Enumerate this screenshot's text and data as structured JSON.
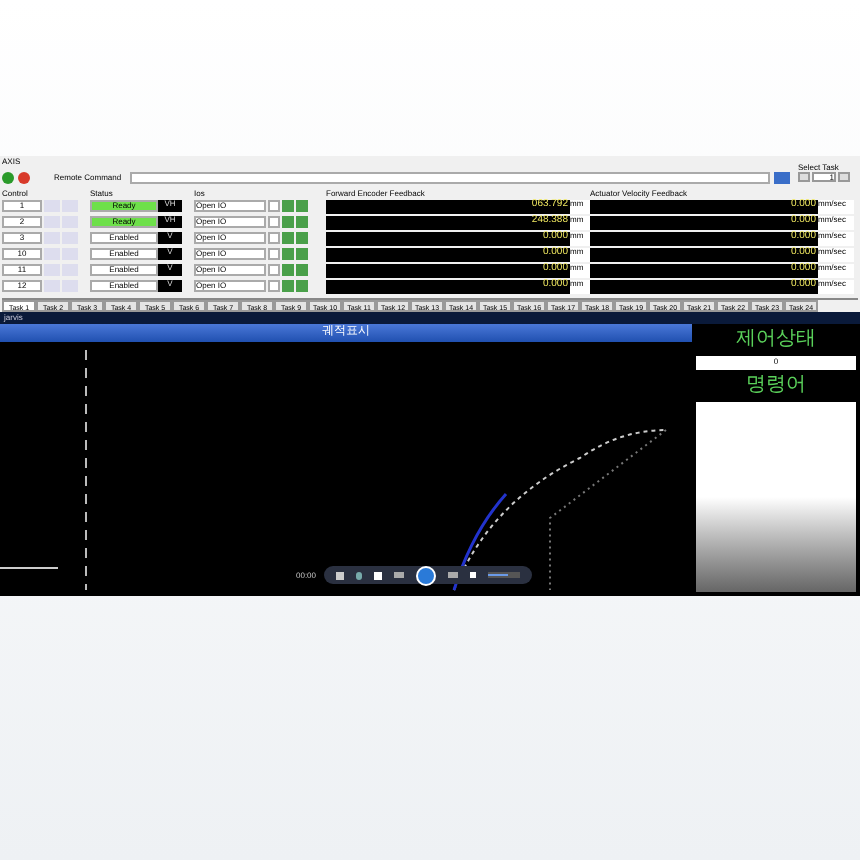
{
  "axis_panel": {
    "title": "AXIS",
    "remote_label": "Remote Command",
    "select_task": {
      "label": "Select Task",
      "value": "1"
    },
    "columns": [
      "Control",
      "Status",
      "Ios",
      "Forward Encoder Feedback",
      "Actuator Velocity Feedback"
    ],
    "rows": [
      {
        "control": "1",
        "checked": false,
        "status": "Ready",
        "ready": true,
        "mode": "VH",
        "io": "Open IO",
        "encoder": "063.792",
        "encoder_unit": "mm",
        "velocity": "0.000",
        "velocity_unit": "mm/sec"
      },
      {
        "control": "2",
        "checked": false,
        "status": "Ready",
        "ready": true,
        "mode": "VH",
        "io": "Open IO",
        "encoder": "248.388",
        "encoder_unit": "mm",
        "velocity": "0.000",
        "velocity_unit": "mm/sec"
      },
      {
        "control": "3",
        "checked": false,
        "status": "Enabled",
        "ready": false,
        "mode": "V",
        "io": "Open IO",
        "encoder": "0.000",
        "encoder_unit": "mm",
        "velocity": "0.000",
        "velocity_unit": "mm/sec"
      },
      {
        "control": "10",
        "checked": false,
        "status": "Enabled",
        "ready": false,
        "mode": "V",
        "io": "Open IO",
        "encoder": "0.000",
        "encoder_unit": "mm",
        "velocity": "0.000",
        "velocity_unit": "mm/sec"
      },
      {
        "control": "11",
        "checked": false,
        "status": "Enabled",
        "ready": false,
        "mode": "V",
        "io": "Open IO",
        "encoder": "0.000",
        "encoder_unit": "mm",
        "velocity": "0.000",
        "velocity_unit": "mm/sec"
      },
      {
        "control": "12",
        "checked": false,
        "status": "Enabled",
        "ready": false,
        "mode": "V",
        "io": "Open IO",
        "encoder": "0.000",
        "encoder_unit": "mm",
        "velocity": "0.000",
        "velocity_unit": "mm/sec"
      }
    ],
    "tabs": [
      {
        "label": "Task 1",
        "selected": true
      },
      {
        "label": "Task 2",
        "selected": false
      },
      {
        "label": "Task 3",
        "selected": false
      },
      {
        "label": "Task 4",
        "selected": false
      },
      {
        "label": "Task 5",
        "selected": false
      },
      {
        "label": "Task 6",
        "selected": false
      },
      {
        "label": "Task 7",
        "selected": false
      },
      {
        "label": "Task 8",
        "selected": false
      },
      {
        "label": "Task 9",
        "selected": false
      },
      {
        "label": "Task 10",
        "selected": false
      },
      {
        "label": "Task 11",
        "selected": false
      },
      {
        "label": "Task 12",
        "selected": false
      },
      {
        "label": "Task 13",
        "selected": false
      },
      {
        "label": "Task 14",
        "selected": false
      },
      {
        "label": "Task 15",
        "selected": false
      },
      {
        "label": "Task 16",
        "selected": false
      },
      {
        "label": "Task 17",
        "selected": false
      },
      {
        "label": "Task 18",
        "selected": false
      },
      {
        "label": "Task 19",
        "selected": false
      },
      {
        "label": "Task 20",
        "selected": false
      },
      {
        "label": "Task 21",
        "selected": false
      },
      {
        "label": "Task 22",
        "selected": false
      },
      {
        "label": "Task 23",
        "selected": false
      },
      {
        "label": "Task 24",
        "selected": false
      }
    ]
  },
  "viewer": {
    "window_title": "jarvis",
    "header": "궤적표시",
    "time": "00:00",
    "volume": {
      "level": 0.6
    },
    "side_panel": {
      "heading_1": "제어상태",
      "spin_value": "0",
      "heading_2": "명령어"
    }
  }
}
